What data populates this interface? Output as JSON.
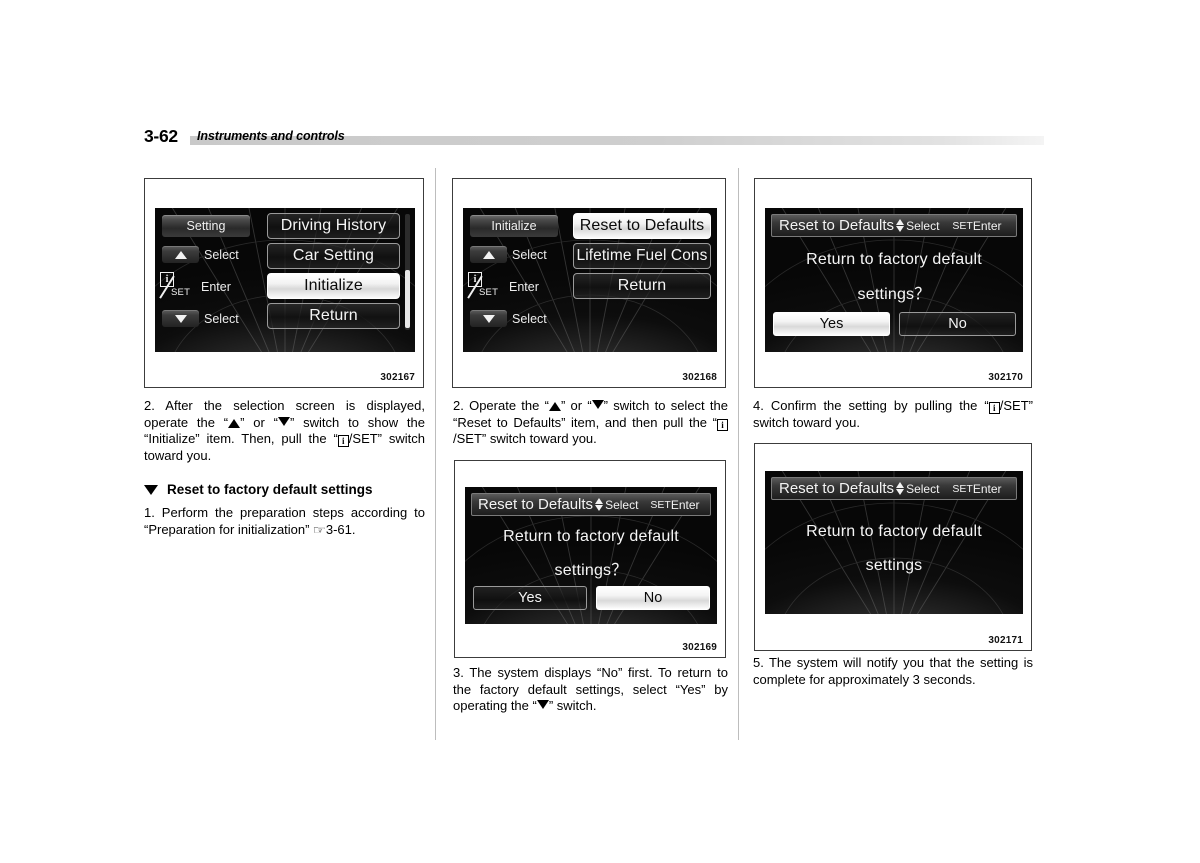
{
  "header": {
    "page_number": "3-62",
    "section_title": "Instruments and controls"
  },
  "figures": {
    "fig1": {
      "caption": "302167",
      "rail": {
        "title": "Setting",
        "up_label": "Select",
        "enter_label": "Enter",
        "info_letter": "i",
        "set_label": "SET",
        "down_label": "Select"
      },
      "menu": [
        {
          "label": "Driving History",
          "selected": false
        },
        {
          "label": "Car Setting",
          "selected": false
        },
        {
          "label": "Initialize",
          "selected": true
        },
        {
          "label": "Return",
          "selected": false
        }
      ]
    },
    "fig2": {
      "caption": "302168",
      "rail": {
        "title": "Initialize",
        "up_label": "Select",
        "enter_label": "Enter",
        "info_letter": "i",
        "set_label": "SET",
        "down_label": "Select"
      },
      "menu": [
        {
          "label": "Reset to Defaults",
          "selected": true
        },
        {
          "label": "Lifetime Fuel Cons",
          "selected": false
        },
        {
          "label": "Return",
          "selected": false
        }
      ]
    },
    "fig3": {
      "caption": "302170",
      "dialog": {
        "title": "Reset to Defaults",
        "select_label": "Select",
        "set_label": "SET",
        "enter_label": "Enter",
        "message_line1": "Return to factory default",
        "message_line2": "settings？",
        "yes_label": "Yes",
        "no_label": "No",
        "selected_button": "Yes"
      }
    },
    "fig4": {
      "caption": "302169",
      "dialog": {
        "title": "Reset to Defaults",
        "select_label": "Select",
        "set_label": "SET",
        "enter_label": "Enter",
        "message_line1": "Return to factory default",
        "message_line2": "settings？",
        "yes_label": "Yes",
        "no_label": "No",
        "selected_button": "No"
      }
    },
    "fig5": {
      "caption": "302171",
      "dialog": {
        "title": "Reset to Defaults",
        "select_label": "Select",
        "set_label": "SET",
        "enter_label": "Enter",
        "message_line1": "Return to factory default",
        "message_line2": "settings"
      }
    }
  },
  "text": {
    "col1_step2_a": "2.  After the selection screen is displayed, operate the “",
    "col1_step2_b": "” or “",
    "col1_step2_c": "” switch to show the “Initialize” item. Then, pull the “",
    "col1_step2_d": "/SET” switch toward you.",
    "subhead": "Reset to factory default settings",
    "col1_step1_a": "1.  Perform the preparation steps according to “Preparation for initialization” ",
    "col1_step1_ref": "☞",
    "col1_step1_b": "3-61.",
    "col2_step2_a": "2.  Operate the “",
    "col2_step2_b": "” or “",
    "col2_step2_c": "” switch to select the “Reset to Defaults” item, and then pull the “",
    "col2_step2_d": "/SET” switch toward you.",
    "col2_step3_a": "3. The system displays “No” first. To return to the factory default settings, select “Yes” by operating the “",
    "col2_step3_b": "” switch.",
    "col3_step4_a": "4.  Confirm the setting by pulling the “",
    "col3_step4_b": "/SET” switch toward you.",
    "col3_step5": "5. The system will notify you that the setting is complete for approximately 3 seconds."
  },
  "colors": {
    "rule_gray": "#c9c9c9",
    "divider_gray": "#bdbdbd",
    "frame": "#3c3c3c",
    "lcd_bg": "#050505",
    "lcd_text": "#f4f4f4"
  }
}
